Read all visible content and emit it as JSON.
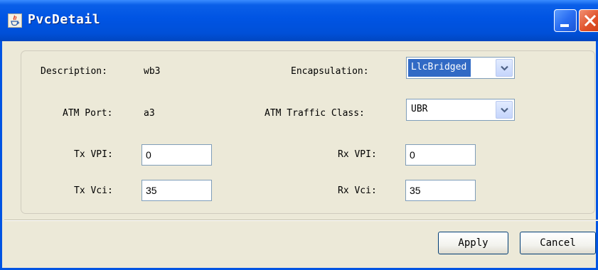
{
  "window": {
    "title": "PvcDetail",
    "icon": "java-cup-icon"
  },
  "form": {
    "description": {
      "label": "Description:",
      "value": "wb3"
    },
    "atm_port": {
      "label": "ATM Port:",
      "value": "a3"
    },
    "tx_vpi": {
      "label": "Tx VPI:",
      "value": "0"
    },
    "tx_vci": {
      "label": "Tx Vci:",
      "value": "35"
    },
    "encapsulation": {
      "label": "Encapsulation:",
      "value": "LlcBridged"
    },
    "atm_traffic_class": {
      "label": "ATM Traffic Class:",
      "value": "UBR"
    },
    "rx_vpi": {
      "label": "Rx VPI:",
      "value": "0"
    },
    "rx_vci": {
      "label": "Rx Vci:",
      "value": "35"
    }
  },
  "buttons": {
    "apply": "Apply",
    "cancel": "Cancel"
  },
  "colors": {
    "titlebar": "#0054e3",
    "window_bg": "#ece9d8",
    "selection": "#316ac5",
    "close_button": "#e0512a"
  }
}
